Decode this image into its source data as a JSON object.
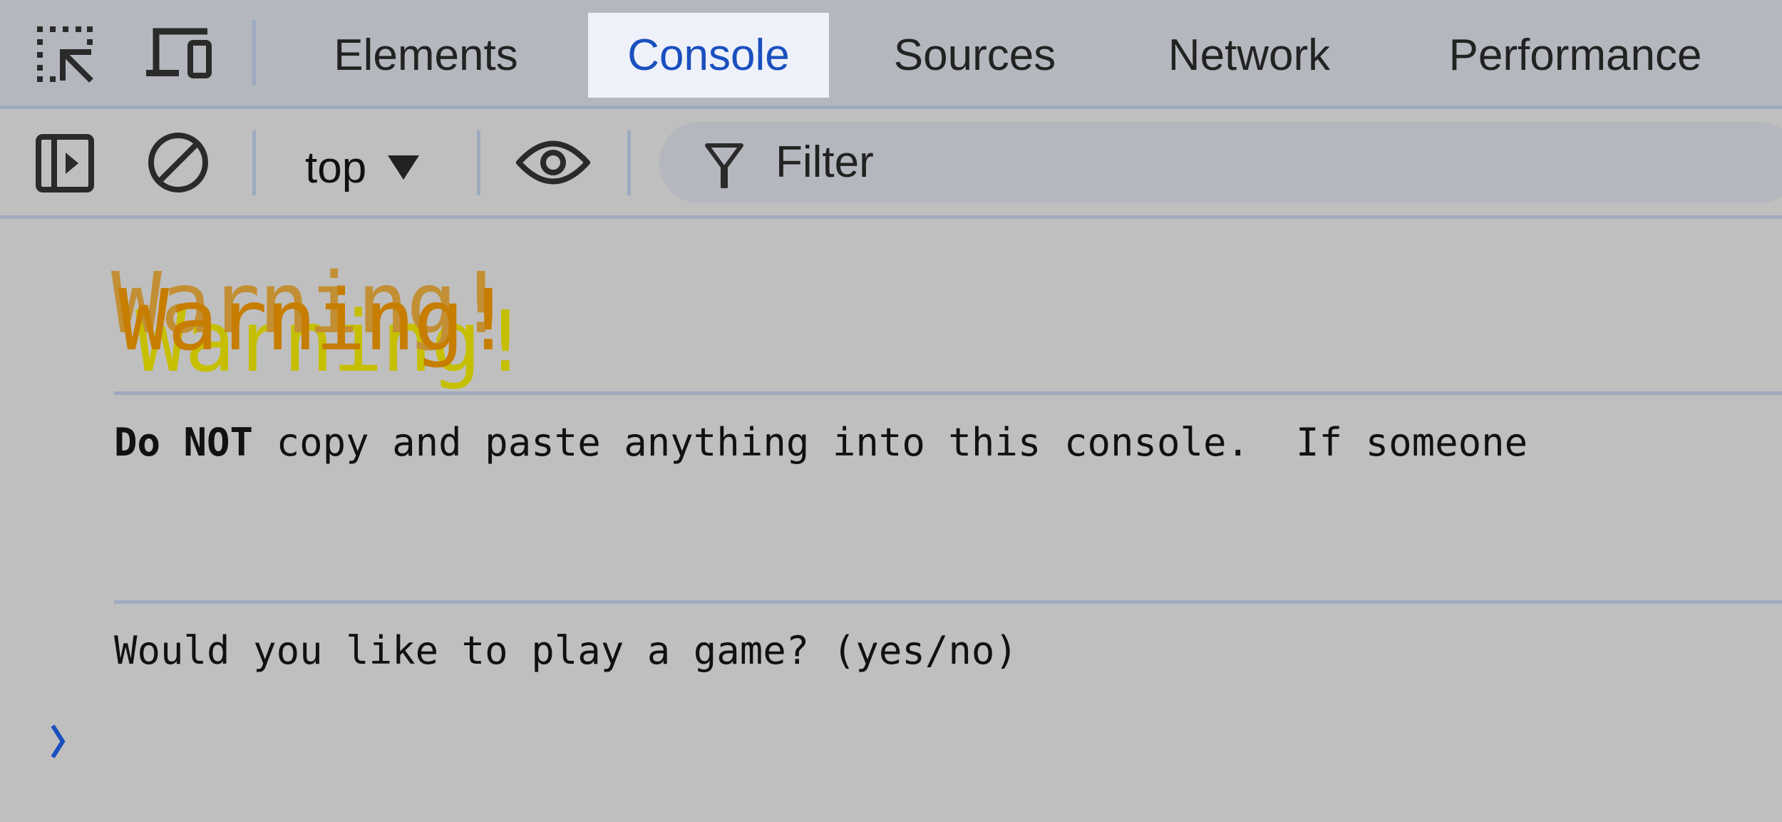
{
  "devtools": {
    "tabs": [
      {
        "label": "Elements",
        "active": false
      },
      {
        "label": "Console",
        "active": true
      },
      {
        "label": "Sources",
        "active": false
      },
      {
        "label": "Network",
        "active": false
      },
      {
        "label": "Performance",
        "active": false
      }
    ],
    "toolbar_icons": [
      "inspect-element-icon",
      "device-toolbar-icon"
    ],
    "console_toolbar": {
      "sidebar_toggle_icon": "sidebar-toggle-icon",
      "clear_icon": "clear-console-icon",
      "context": "top",
      "live_expression_icon": "eye-icon",
      "filter_placeholder": "Filter"
    },
    "colors": {
      "accent": "#1a4fbf",
      "warning_yellow": "#c6bf00",
      "warning_tan": "#c38f34",
      "warning_orange": "#c77d00"
    }
  },
  "console": {
    "messages": [
      {
        "type": "styled",
        "text": "Warning!"
      },
      {
        "type": "log",
        "bold": "Do NOT",
        "text": " copy and paste anything into this console.  If someone "
      },
      {
        "type": "log",
        "text": "Would you like to play a game? (yes/no)"
      }
    ],
    "prompt_symbol": "›"
  }
}
